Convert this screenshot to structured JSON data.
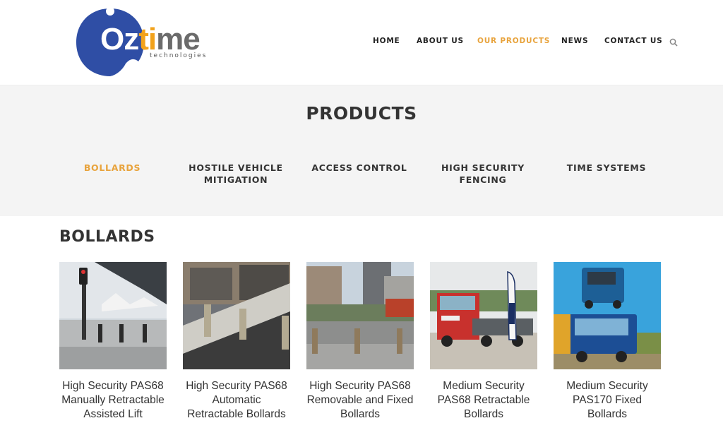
{
  "brand": {
    "logo_word_a": "Oz",
    "logo_word_b": "ti",
    "logo_word_c": "me",
    "logo_sub": "technologies",
    "colors": {
      "blue": "#2f4ea5",
      "orange": "#f2a21b",
      "accent": "#e8a33c"
    }
  },
  "nav": {
    "items": [
      {
        "label": "HOME",
        "active": false
      },
      {
        "label": "ABOUT US",
        "active": false
      },
      {
        "label": "OUR PRODUCTS",
        "active": true
      },
      {
        "label": "NEWS",
        "active": false
      },
      {
        "label": "CONTACT US",
        "active": false
      }
    ],
    "search_icon": "search-icon"
  },
  "products": {
    "title": "PRODUCTS",
    "categories": [
      {
        "label": "BOLLARDS",
        "active": true
      },
      {
        "label": "HOSTILE VEHICLE MITIGATION",
        "active": false
      },
      {
        "label": "ACCESS CONTROL",
        "active": false
      },
      {
        "label": "HIGH SECURITY FENCING",
        "active": false
      },
      {
        "label": "TIME SYSTEMS",
        "active": false
      }
    ]
  },
  "section": {
    "title": "BOLLARDS",
    "cards": [
      {
        "title": "High Security PAS68 Manually Retractable Assisted Lift"
      },
      {
        "title": "High Security PAS68 Automatic Retractable Bollards"
      },
      {
        "title": "High Security PAS68 Removable and Fixed Bollards"
      },
      {
        "title": "Medium Security PAS68 Retractable Bollards"
      },
      {
        "title": "Medium Security PAS170 Fixed Bollards"
      }
    ]
  }
}
